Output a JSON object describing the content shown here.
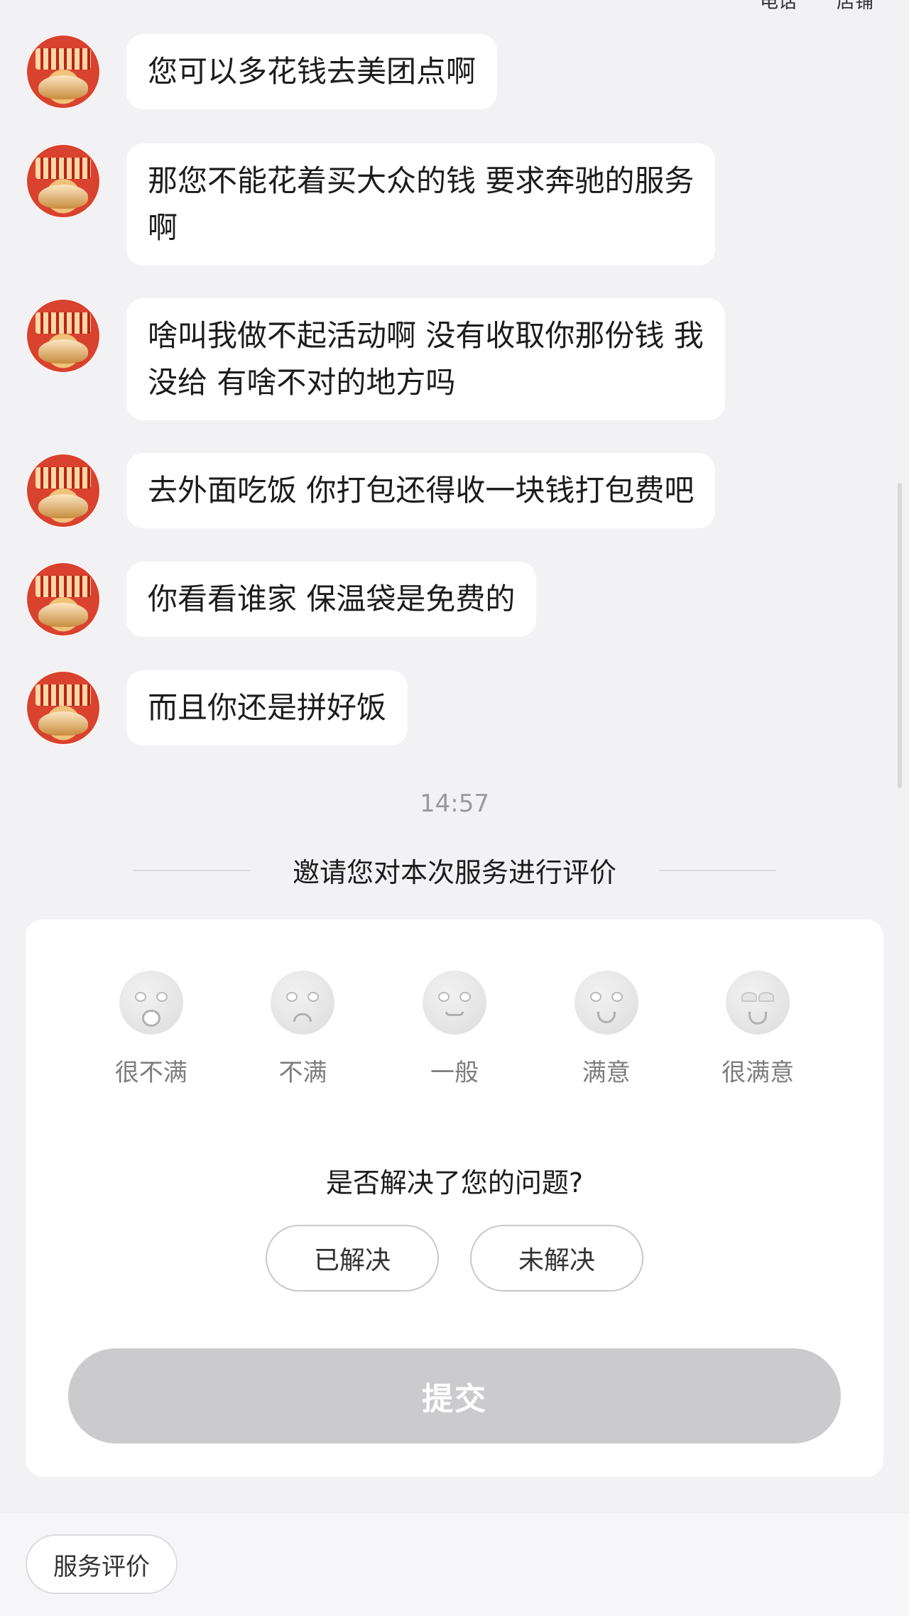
{
  "header": {
    "links": [
      "电话",
      "店铺"
    ]
  },
  "messages": [
    {
      "text": "您可以多花钱去美团点啊"
    },
    {
      "text": "那您不能花着买大众的钱 要求奔驰的服务\n啊"
    },
    {
      "text": "啥叫我做不起活动啊 没有收取你那份钱 我\n没给 有啥不对的地方吗"
    },
    {
      "text": "去外面吃饭 你打包还得收一块钱打包费吧"
    },
    {
      "text": "你看看谁家 保温袋是免费的"
    },
    {
      "text": "而且你还是拼好饭"
    }
  ],
  "timestamp": "14:57",
  "rating": {
    "invite_text": "邀请您对本次服务进行评价",
    "options": [
      {
        "label": "很不满",
        "icon": "very-dissatisfied-face-icon"
      },
      {
        "label": "不满",
        "icon": "dissatisfied-face-icon"
      },
      {
        "label": "一般",
        "icon": "neutral-face-icon"
      },
      {
        "label": "满意",
        "icon": "satisfied-face-icon"
      },
      {
        "label": "很满意",
        "icon": "very-satisfied-face-icon"
      }
    ],
    "question": "是否解决了您的问题?",
    "resolved_label": "已解决",
    "unresolved_label": "未解决",
    "submit_label": "提交"
  },
  "bottom": {
    "service_eval_label": "服务评价"
  }
}
